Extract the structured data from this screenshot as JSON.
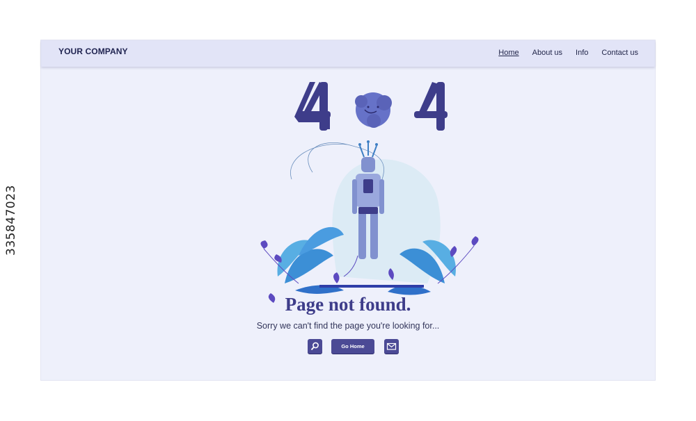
{
  "stock_id": "335847023",
  "header": {
    "company": "YOUR COMPANY",
    "nav": [
      "Home",
      "About us",
      "Info",
      "Contact us"
    ],
    "active_nav": "Home"
  },
  "hero": {
    "error_code": "404",
    "title": "Page not found.",
    "subtitle": "Sorry we can't find the page you're looking for..."
  },
  "actions": {
    "home_label": "Go Home",
    "search_icon": "search-icon",
    "mail_icon": "mail-icon"
  },
  "colors": {
    "accent": "#4b4a95",
    "digits": "#3e3d8a",
    "background": "#eef0fb",
    "navbar": "#e2e4f7"
  }
}
